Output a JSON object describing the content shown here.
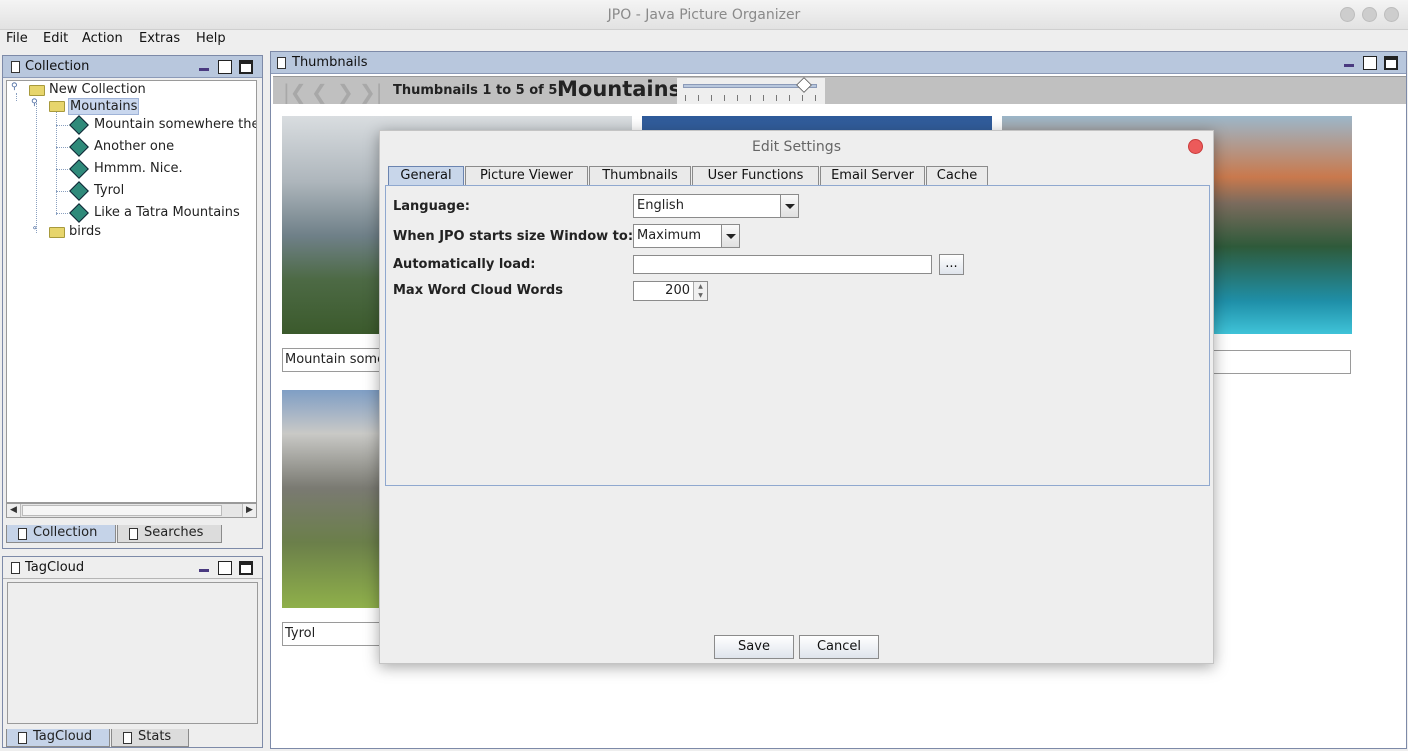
{
  "window": {
    "title": "JPO - Java Picture Organizer"
  },
  "menubar": {
    "items": [
      "File",
      "Edit",
      "Action",
      "Extras",
      "Help"
    ]
  },
  "collection_panel": {
    "title": "Collection",
    "tree": {
      "root": "New Collection",
      "selected_folder": "Mountains",
      "pictures": [
        "Mountain somewhere ther",
        "Another one",
        "Hmmm. Nice.",
        "Tyrol",
        "Like a Tatra Mountains"
      ],
      "other_folder": "birds"
    },
    "tabs": [
      "Collection",
      "Searches"
    ]
  },
  "tagcloud_panel": {
    "title": "TagCloud",
    "tabs": [
      "TagCloud",
      "Stats"
    ]
  },
  "thumbnails_panel": {
    "title": "Thumbnails",
    "status": "Thumbnails 1 to 5 of 5",
    "group_name": "Mountains",
    "size_slider": 0.9,
    "captions": [
      "Mountain somev",
      "Tyrol"
    ]
  },
  "dialog": {
    "title": "Edit Settings",
    "tabs": [
      "General",
      "Picture Viewer",
      "Thumbnails",
      "User Functions",
      "Email Server",
      "Cache"
    ],
    "fields": {
      "language_label": "Language:",
      "language_value": "English",
      "startsize_label": "When JPO starts size Window to:",
      "startsize_value": "Maximum",
      "autoload_label": "Automatically load:",
      "autoload_value": "",
      "browse_label": "...",
      "wordcloud_label": "Max Word Cloud Words",
      "wordcloud_value": "200"
    },
    "save_label": "Save",
    "cancel_label": "Cancel"
  },
  "colors": {
    "frame_header": "#b8c7dd",
    "toolbar": "#c0c0c0",
    "close_button": "#ec5a5a"
  }
}
